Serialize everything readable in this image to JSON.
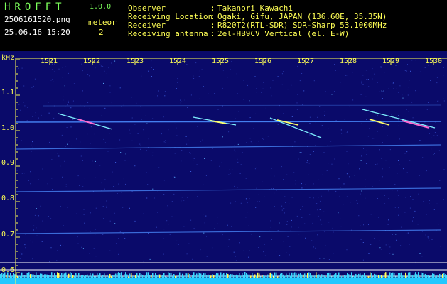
{
  "header": {
    "logo": "HROFFT",
    "version": "1.0.0",
    "filename": "2506161520.png",
    "datetime": "25.06.16 15:20",
    "meteor_label": "meteor",
    "meteor_count": "2",
    "info": [
      {
        "key": "Observer",
        "sep": ":",
        "value": "Takanori Kawachi"
      },
      {
        "key": "Receiving Location",
        "sep": ":",
        "value": "Ogaki, Gifu, JAPAN (136.60E, 35.35N)"
      },
      {
        "key": "Receiver",
        "sep": ":",
        "value": "R820T2(RTL-SDR) SDR-Sharp 53.1000MHz"
      },
      {
        "key": "Receiving antenna",
        "sep": ":",
        "value": "2el-HB9CV Vertical (el. E-W)"
      }
    ]
  },
  "spectrogram": {
    "y_unit": "kHz",
    "y_ticks": [
      "1.1",
      "1.0",
      "0.9",
      "0.8",
      "0.7",
      "0.6"
    ],
    "x_ticks": [
      "1521",
      "1522",
      "1523",
      "1524",
      "1525",
      "1526",
      "1527",
      "1528",
      "1529",
      "1530"
    ],
    "bg_color": "#0a0a6a",
    "tick_color": "#ffff55",
    "line_color": "#4a8cff"
  }
}
